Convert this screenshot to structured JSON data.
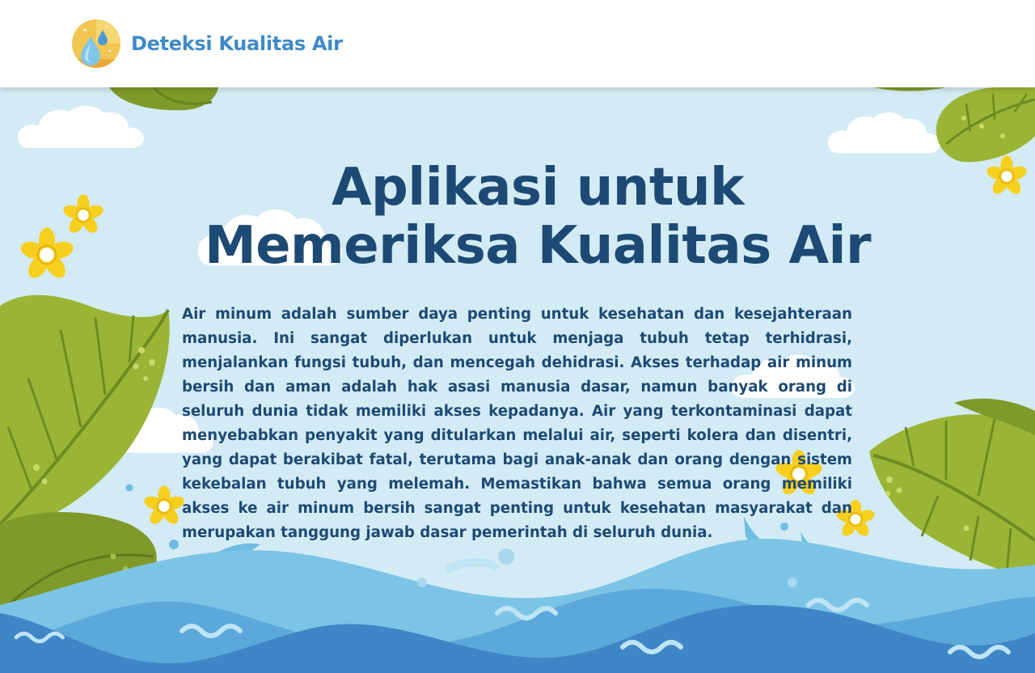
{
  "header": {
    "brand": "Deteksi Kualitas Air",
    "logo_icon": "water-drop-logo-icon"
  },
  "hero": {
    "title_line1": "Aplikasi untuk",
    "title_line2": "Memeriksa Kualitas Air",
    "paragraph": "Air minum adalah sumber daya penting untuk kesehatan dan kesejahteraan manusia. Ini sangat diperlukan untuk menjaga tubuh tetap terhidrasi, menjalankan fungsi tubuh, dan mencegah dehidrasi. Akses terhadap air minum bersih dan aman adalah hak asasi manusia dasar, namun banyak orang di seluruh dunia tidak memiliki akses kepadanya. Air yang terkontaminasi dapat menyebabkan penyakit yang ditularkan melalui air, seperti kolera dan disentri, yang dapat berakibat fatal, terutama bagi anak-anak dan orang dengan sistem kekebalan tubuh yang melemah. Memastikan bahwa semua orang memiliki akses ke air minum bersih sangat penting untuk kesehatan masyarakat dan merupakan tanggung jawab dasar pemerintah di seluruh dunia."
  },
  "colors": {
    "brand": "#3f8ac9",
    "heading": "#1d4a74",
    "sky": "#d3ebf4",
    "water_light": "#7cc4e6",
    "water_dark": "#3f86c6",
    "leaf": "#9ab536",
    "flower": "#f7cf1f"
  }
}
